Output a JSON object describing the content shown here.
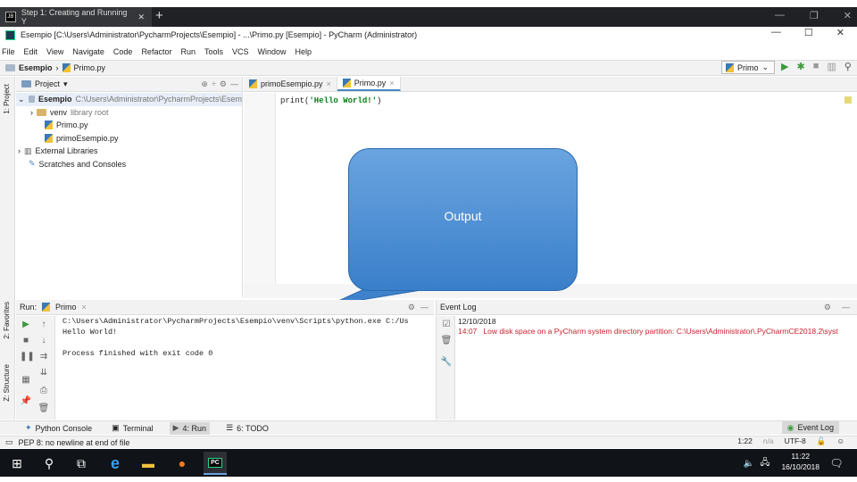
{
  "browser": {
    "tab_title": "Step 1: Creating and Running Y",
    "favicon_label": "JB",
    "close": "✕",
    "new_tab": "+"
  },
  "window": {
    "title": "Esempio [C:\\Users\\Administrator\\PycharmProjects\\Esempio] - ...\\Primo.py [Esempio] - PyCharm (Administrator)",
    "minimize": "—",
    "maximize": "☐",
    "close": "✕"
  },
  "menu": [
    "File",
    "Edit",
    "View",
    "Navigate",
    "Code",
    "Refactor",
    "Run",
    "Tools",
    "VCS",
    "Window",
    "Help"
  ],
  "breadcrumb": {
    "project": "Esempio",
    "file": "Primo.py"
  },
  "run_config": {
    "name": "Primo"
  },
  "left_strip": {
    "project": "1: Project",
    "favorites": "2: Favorites",
    "structure": "Z: Structure"
  },
  "project_panel": {
    "title": "Project",
    "tree": [
      {
        "label": "Esempio",
        "extra": "C:\\Users\\Administrator\\PycharmProjects\\Esem",
        "indent": 0,
        "type": "folder"
      },
      {
        "label": "venv",
        "extra": "library root",
        "indent": 1,
        "type": "folder"
      },
      {
        "label": "Primo.py",
        "extra": "",
        "indent": 2,
        "type": "py"
      },
      {
        "label": "primoEsempio.py",
        "extra": "",
        "indent": 2,
        "type": "py"
      },
      {
        "label": "External Libraries",
        "extra": "",
        "indent": 0,
        "type": "lib"
      },
      {
        "label": "Scratches and Consoles",
        "extra": "",
        "indent": 0,
        "type": "scratch"
      }
    ]
  },
  "editor": {
    "tabs": [
      {
        "label": "primoEsempio.py",
        "active": false
      },
      {
        "label": "Primo.py",
        "active": true
      }
    ],
    "code_fn": "print(",
    "code_str": "'Hello World!'",
    "code_close": ")"
  },
  "callout": {
    "text": "Output"
  },
  "run_panel": {
    "label": "Run:",
    "config": "Primo",
    "lines": [
      "C:\\Users\\Administrator\\PycharmProjects\\Esempio\\venv\\Scripts\\python.exe C:/Us",
      "Hello World!",
      "",
      "Process finished with exit code 0"
    ]
  },
  "event_log": {
    "title": "Event Log",
    "date": "12/10/2018",
    "time": "14:07",
    "message": "Low disk space on a PyCharm system directory partition: C:\\Users\\Administrator\\.PyCharmCE2018.2\\syst"
  },
  "tool_tabs": [
    {
      "label": "Python Console",
      "active": false
    },
    {
      "label": "Terminal",
      "active": false
    },
    {
      "label": "4: Run",
      "active": true
    },
    {
      "label": "6: TODO",
      "active": false
    }
  ],
  "event_log_tab": "Event Log",
  "status": {
    "message": "PEP 8: no newline at end of file",
    "position": "1:22",
    "line_sep": "n/a",
    "encoding": "UTF-8"
  },
  "clock": {
    "time": "11:22",
    "date": "16/10/2018"
  },
  "colors": {
    "accent": "#4a88c7",
    "callout": "#3a7fca",
    "error": "#c7222d",
    "taskbar": "#101317"
  }
}
